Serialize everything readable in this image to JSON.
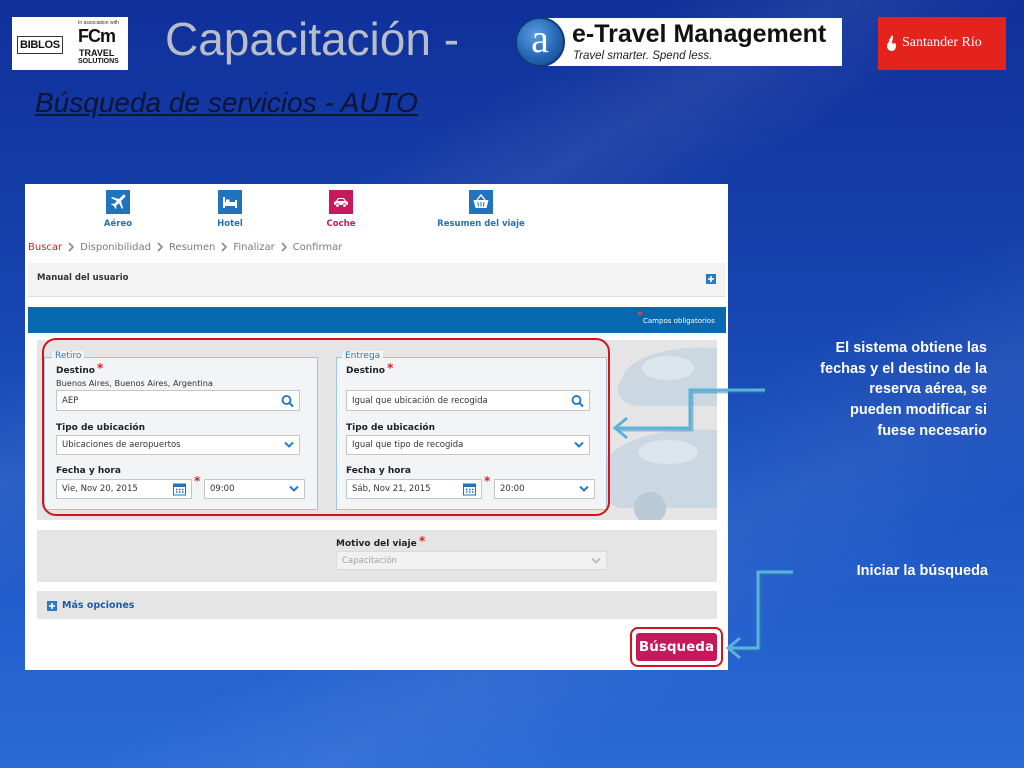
{
  "header": {
    "partner_logo": {
      "name": "BIBLOS",
      "association": "In association with",
      "brand": "FCm",
      "brand_line1": "TRAVEL",
      "brand_line2": "SOLUTIONS"
    },
    "title": "Capacitación -",
    "etravel_logo": {
      "mark": "a",
      "name": "e-Travel Management",
      "tagline": "Travel smarter. Spend less."
    },
    "bank_logo": {
      "name": "Santander Río",
      "icon": "flame-icon"
    }
  },
  "subtitle": "Búsqueda de servicios - AUTO",
  "app": {
    "nav": [
      {
        "label": "Aéreo",
        "icon": "plane-icon",
        "active": false
      },
      {
        "label": "Hotel",
        "icon": "bed-icon",
        "active": false
      },
      {
        "label": "Coche",
        "icon": "car-icon",
        "active": true
      },
      {
        "label": "Resumen del viaje",
        "icon": "basket-icon",
        "active": false
      }
    ],
    "breadcrumb": [
      {
        "label": "Buscar",
        "active": true
      },
      {
        "label": "Disponibilidad",
        "active": false
      },
      {
        "label": "Resumen",
        "active": false
      },
      {
        "label": "Finalizar",
        "active": false
      },
      {
        "label": "Confirmar",
        "active": false
      }
    ],
    "manual": {
      "label": "Manual del usuario",
      "icon": "plus-icon"
    },
    "required_marker": "*",
    "required_note": "Campos obligatorios",
    "pickup": {
      "legend": "Retiro",
      "destination_label": "Destino",
      "destination_location": "Buenos Aires, Buenos Aires, Argentina",
      "destination_value": "AEP",
      "location_type_label": "Tipo de ubicación",
      "location_type_value": "Ubicaciones de aeropuertos",
      "datetime_label": "Fecha y hora",
      "date_value": "Vie, Nov 20, 2015",
      "time_value": "09:00"
    },
    "dropoff": {
      "legend": "Entrega",
      "destination_label": "Destino",
      "destination_value": "Igual que ubicación de recogida",
      "location_type_label": "Tipo de ubicación",
      "location_type_value": "Igual que tipo de recogida",
      "datetime_label": "Fecha y hora",
      "date_value": "Sáb, Nov 21, 2015",
      "time_value": "20:00"
    },
    "trip_reason": {
      "label": "Motivo del viaje",
      "value": "Capacitación",
      "disabled": true
    },
    "more_options": {
      "label": "Más opciones",
      "icon": "plus-icon"
    },
    "search_button": {
      "label": "Búsqueda"
    }
  },
  "annotations": {
    "fields_note": [
      "El sistema obtiene las",
      "fechas y el destino de la",
      "reserva aérea, se",
      "pueden modificar si",
      "fuese necesario"
    ],
    "search_note": "Iniciar la búsqueda"
  },
  "colors": {
    "slide_background": "#1642ad",
    "title_gray": "#b8bdc7",
    "accent_blue": "#1f74bd",
    "active_magenta": "#c8195e",
    "highlight_red": "#d3141c",
    "arrow_blue": "#5ab4da",
    "breadcrumb_active": "#d0202a",
    "bank_red": "#e4231c"
  }
}
